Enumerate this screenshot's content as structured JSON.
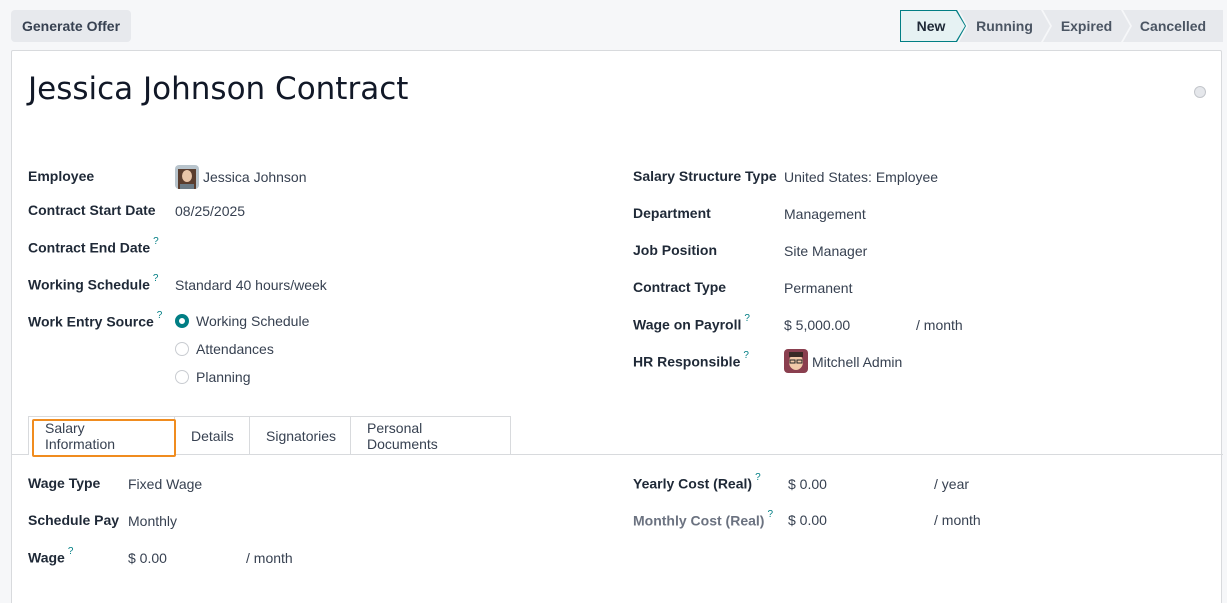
{
  "toolbar": {
    "generate_offer": "Generate Offer"
  },
  "statusbar": {
    "steps": [
      "New",
      "Running",
      "Expired",
      "Cancelled"
    ],
    "active": "New"
  },
  "record": {
    "title": "Jessica Johnson Contract"
  },
  "left_fields": {
    "employee": {
      "label": "Employee",
      "value": "Jessica Johnson"
    },
    "start_date": {
      "label": "Contract Start Date",
      "value": "08/25/2025"
    },
    "end_date": {
      "label": "Contract End Date",
      "help": "?",
      "value": ""
    },
    "schedule": {
      "label": "Working Schedule",
      "help": "?",
      "value": "Standard 40 hours/week"
    },
    "work_entry": {
      "label": "Work Entry Source",
      "help": "?",
      "options": [
        "Working Schedule",
        "Attendances",
        "Planning"
      ],
      "selected": "Working Schedule"
    }
  },
  "right_fields": {
    "structure_type": {
      "label": "Salary Structure Type",
      "value": "United States: Employee"
    },
    "department": {
      "label": "Department",
      "value": "Management"
    },
    "job_position": {
      "label": "Job Position",
      "value": "Site Manager"
    },
    "contract_type": {
      "label": "Contract Type",
      "value": "Permanent"
    },
    "wage_payroll": {
      "label": "Wage on Payroll",
      "help": "?",
      "value": "$ 5,000.00",
      "unit": "/ month"
    },
    "hr_responsible": {
      "label": "HR Responsible",
      "help": "?",
      "value": "Mitchell Admin"
    }
  },
  "tabs": [
    "Salary Information",
    "Details",
    "Signatories",
    "Personal Documents"
  ],
  "salary": {
    "wage_type": {
      "label": "Wage Type",
      "value": "Fixed Wage"
    },
    "schedule_pay": {
      "label": "Schedule Pay",
      "value": "Monthly"
    },
    "wage": {
      "label": "Wage",
      "help": "?",
      "value": "$ 0.00",
      "unit": "/ month"
    },
    "yearly_cost": {
      "label": "Yearly Cost (Real)",
      "help": "?",
      "value": "$ 0.00",
      "unit": "/ year"
    },
    "monthly_cost": {
      "label": "Monthly Cost (Real)",
      "help": "?",
      "value": "$ 0.00",
      "unit": "/ month"
    }
  },
  "colors": {
    "accent": "#017e84",
    "focus": "#f08c1f"
  }
}
